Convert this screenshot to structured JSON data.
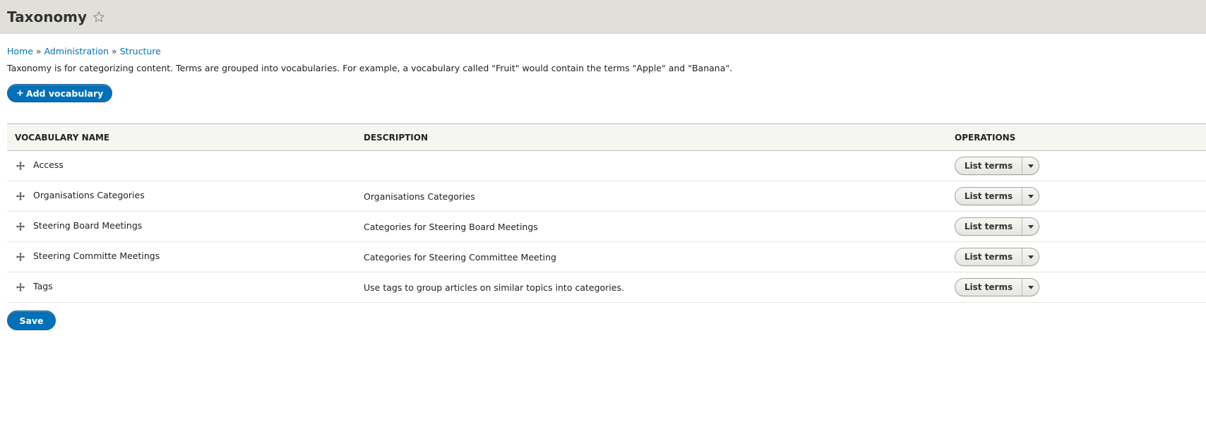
{
  "page": {
    "title": "Taxonomy",
    "star_icon": "star-outline-icon"
  },
  "breadcrumb": {
    "items": [
      "Home",
      "Administration",
      "Structure"
    ],
    "separator": "»"
  },
  "description": "Taxonomy is for categorizing content. Terms are grouped into vocabularies. For example, a vocabulary called \"Fruit\" would contain the terms \"Apple\" and \"Banana\".",
  "actions": {
    "add_vocabulary_plus": "+",
    "add_vocabulary_label": "Add vocabulary",
    "save_label": "Save"
  },
  "table": {
    "headers": {
      "name": "VOCABULARY NAME",
      "description": "DESCRIPTION",
      "operations": "OPERATIONS"
    },
    "rows": [
      {
        "name": "Access",
        "description": "",
        "operation": "List terms"
      },
      {
        "name": "Organisations Categories",
        "description": "Organisations Categories",
        "operation": "List terms"
      },
      {
        "name": "Steering Board Meetings",
        "description": "Categories for Steering Board Meetings",
        "operation": "List terms"
      },
      {
        "name": "Steering Committe Meetings",
        "description": "Categories for Steering Committee Meeting",
        "operation": "List terms"
      },
      {
        "name": "Tags",
        "description": "Use tags to group articles on similar topics into categories.",
        "operation": "List terms"
      }
    ]
  },
  "colors": {
    "header_bg": "#e0e0d8",
    "link": "#0074bd",
    "primary_button": "#0071b8"
  }
}
